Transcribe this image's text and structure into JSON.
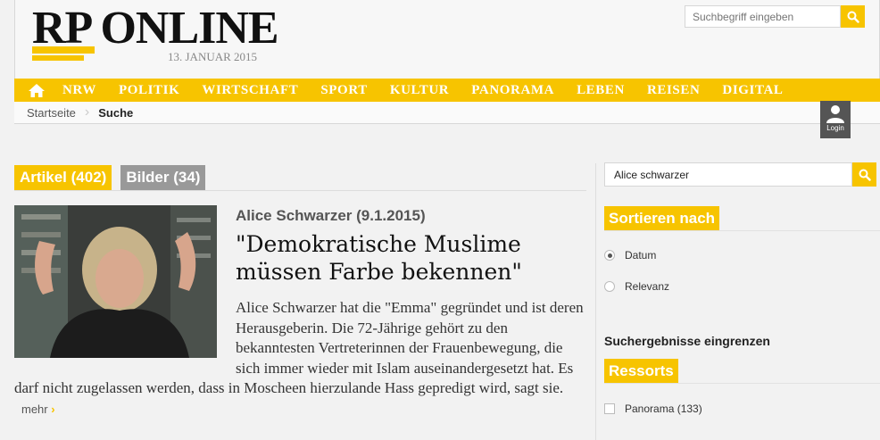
{
  "brand": {
    "logo_text": "RP ONLINE",
    "date": "13. JANUAR 2015"
  },
  "header_search": {
    "placeholder": "Suchbegriff eingeben",
    "icon": "search-icon"
  },
  "nav": {
    "home_icon": "home-icon",
    "items": [
      "NRW",
      "POLITIK",
      "WIRTSCHAFT",
      "SPORT",
      "KULTUR",
      "PANORAMA",
      "LEBEN",
      "REISEN",
      "DIGITAL"
    ]
  },
  "breadcrumb": {
    "items": [
      "Startseite",
      "Suche"
    ]
  },
  "login": {
    "label": "Login",
    "icon": "user-icon"
  },
  "tabs": [
    {
      "label": "Artikel (402)",
      "active": true
    },
    {
      "label": "Bilder (34)",
      "active": false
    }
  ],
  "article": {
    "kicker": "Alice Schwarzer (9.1.2015)",
    "headline": "\"Demokratische Muslime müssen Farbe bekennen\"",
    "teaser": "Alice Schwarzer hat die \"Emma\" gegründet und ist deren Herausgeberin. Die 72-Jährige gehört zu den bekanntesten Vertreterinnen der Frauenbewegung, die sich immer wieder mit Islam auseinandergesetzt hat. Es darf nicht zugelassen werden, dass in Moscheen hierzulande Hass gepredigt wird, sagt sie.",
    "more_label": "mehr",
    "more_icon": "chevron-right-icon"
  },
  "sidebar": {
    "search_value": "Alice schwarzer",
    "sort_title": "Sortieren nach",
    "sort_options": [
      {
        "label": "Datum",
        "selected": true
      },
      {
        "label": "Relevanz",
        "selected": false
      }
    ],
    "filter_title": "Suchergebnisse eingrenzen",
    "ressorts_title": "Ressorts",
    "ressorts": [
      {
        "label": "Panorama (133)",
        "checked": false
      }
    ]
  },
  "colors": {
    "accent": "#f7c400",
    "tab_inactive": "#999999",
    "background": "#f2f2f2"
  }
}
